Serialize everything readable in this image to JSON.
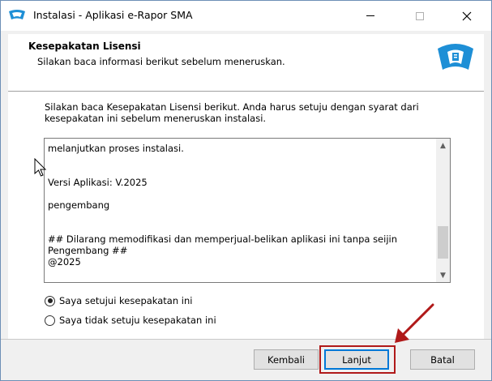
{
  "window": {
    "title": "Instalasi - Aplikasi e-Rapor SMA"
  },
  "header": {
    "title": "Kesepakatan Lisensi",
    "subtitle": "Silakan baca informasi berikut sebelum meneruskan."
  },
  "main": {
    "intro": "Silakan baca Kesepakatan Lisensi berikut. Anda harus setuju dengan syarat dari kesepakatan ini sebelum meneruskan instalasi.",
    "license_lines": [
      "melanjutkan proses instalasi.",
      "",
      "",
      "Versi Aplikasi: V.2025",
      "",
      "pengembang",
      "",
      "",
      "## Dilarang memodifikasi dan memperjual-belikan aplikasi ini tanpa seijin Pengembang ##",
      "@2025"
    ],
    "radio_options": [
      {
        "label": "Saya setujui kesepakatan ini",
        "checked": true
      },
      {
        "label": "Saya tidak setuju kesepakatan ini",
        "checked": false
      }
    ]
  },
  "buttons": {
    "back": "Kembali",
    "next": "Lanjut",
    "cancel": "Batal"
  },
  "colors": {
    "accent": "#0078d7",
    "highlight": "#b01919",
    "logo_blue": "#1e8fd6"
  }
}
